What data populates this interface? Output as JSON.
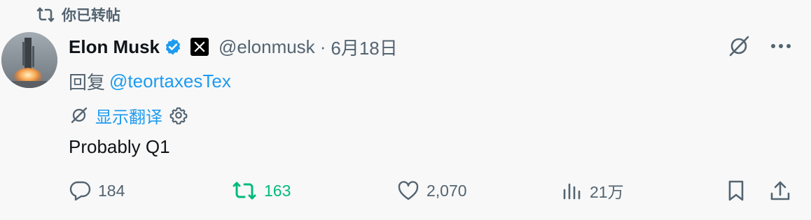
{
  "repost_banner": {
    "text": "你已转帖",
    "icon": "repost-icon"
  },
  "author": {
    "name": "Elon Musk",
    "verified": true,
    "affiliate_badge": "x-logo-icon",
    "handle": "@elonmusk",
    "separator": "·",
    "date": "6月18日"
  },
  "reply": {
    "prefix": "回复",
    "mention": "@teortaxesTex"
  },
  "translate": {
    "label": "显示翻译"
  },
  "tweet": {
    "text": "Probably Q1"
  },
  "actions": {
    "replies": "184",
    "reposts": "163",
    "likes": "2,070",
    "views": "21万"
  },
  "colors": {
    "accent": "#1d9bf0",
    "muted": "#536471",
    "repost_active": "#00ba7c",
    "text": "#0f1419",
    "background": "#f8f8f8"
  }
}
